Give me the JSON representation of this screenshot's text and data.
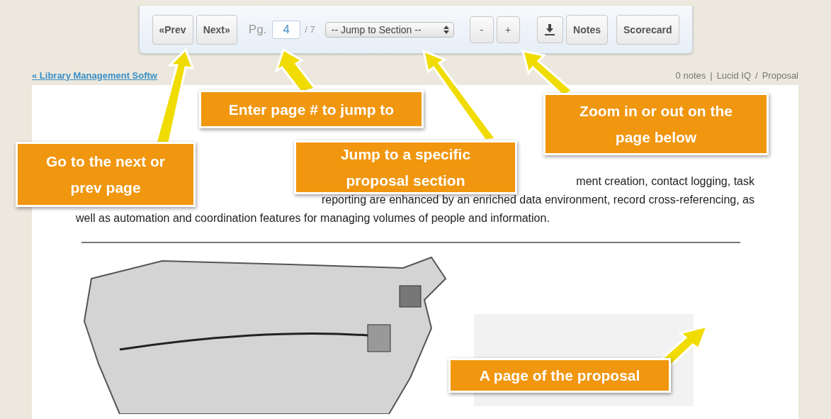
{
  "toolbar": {
    "prev_button": "«Prev",
    "next_button": "Next»",
    "page_label": "Pg.",
    "page_input": {
      "value": "4"
    },
    "page_total": "/ 7",
    "section_select": {
      "value": "-- Jump to Section --"
    },
    "zoom_out_button": "-",
    "zoom_in_button": "+",
    "notes_button": "Notes",
    "scorecard_button": "Scorecard"
  },
  "breadcrumb": "« Library Management Softw",
  "meta": {
    "notes_count": "0 notes",
    "separator_1": "|",
    "company": "Lucid IQ",
    "separator_2": "/",
    "page_name": "Proposal"
  },
  "document": {
    "paragraph_lines": [
      "ment creation, contact logging, task",
      "reporting are enhanced by an enriched data environment, record cross-referencing, as",
      "well as automation and coordination features for managing volumes of people and information."
    ]
  },
  "callouts": [
    {
      "text": "Enter page # to jump to"
    },
    {
      "text": "Zoom in or out on the page below"
    },
    {
      "text": "Go to the next or prev page"
    },
    {
      "text": "Jump to a specific proposal section"
    },
    {
      "text": "A page of the proposal"
    }
  ]
}
